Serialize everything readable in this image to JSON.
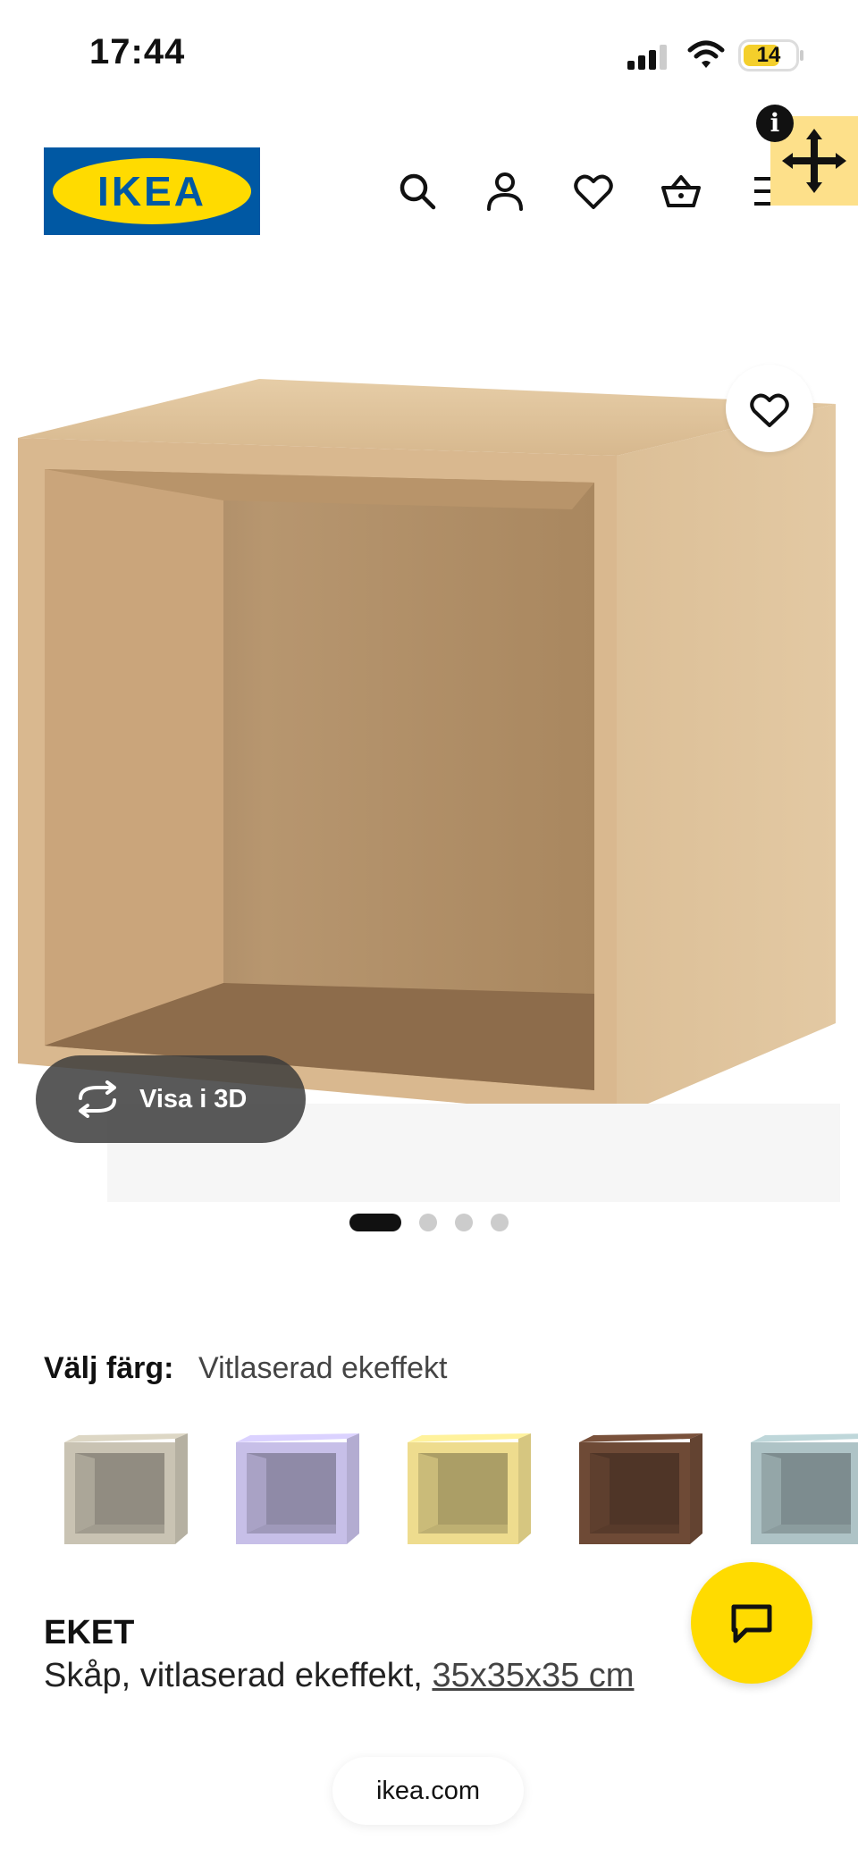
{
  "status_bar": {
    "time": "17:44",
    "battery": "14"
  },
  "header": {
    "logo_text": "IKEA",
    "icons": [
      "search-icon",
      "user-icon",
      "heart-icon",
      "basket-icon",
      "menu-icon"
    ]
  },
  "product_image": {
    "view_3d_label": "Visa i 3D",
    "carousel_count": 4,
    "carousel_active": 1
  },
  "color_select": {
    "label": "Välj färg:",
    "selected": "Vitlaserad ekeffekt",
    "swatches": [
      {
        "color": "#c9c3b3"
      },
      {
        "color": "#c7bfe8"
      },
      {
        "color": "#eedc8e"
      },
      {
        "color": "#6e4a36"
      },
      {
        "color": "#aec3c6"
      }
    ]
  },
  "product": {
    "name": "EKET",
    "description": "Skåp, vitlaserad ekeffekt,",
    "dimensions": "35x35x35 cm"
  },
  "browser": {
    "url": "ikea.com"
  },
  "colors": {
    "ikea_blue": "#0058a3",
    "ikea_yellow": "#ffdb00",
    "wood": "#d9b88f"
  }
}
